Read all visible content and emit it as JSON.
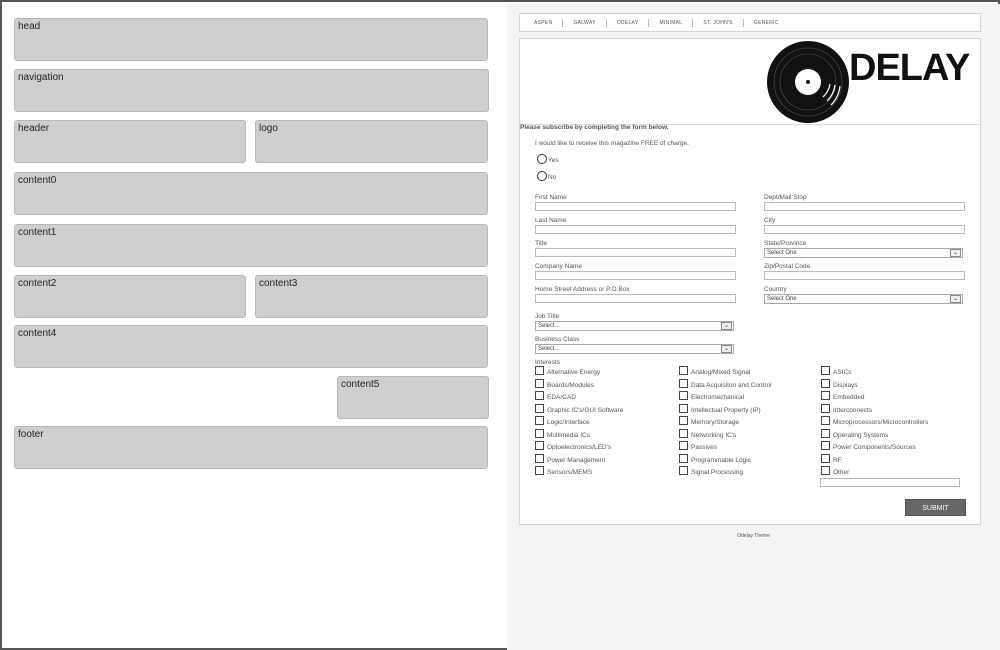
{
  "wireframe": {
    "head": "head",
    "navigation": "navigation",
    "header": "header",
    "logo": "logo",
    "content0": "content0",
    "content1": "content1",
    "content2": "content2",
    "content3": "content3",
    "content4": "content4",
    "content5": "content5",
    "footer": "footer"
  },
  "nav": [
    "ASPEN",
    "GALWAY",
    "ODELAY",
    "MINIMAL",
    "ST. JOHN'S",
    "GENERIC"
  ],
  "brand": "DELAY",
  "form": {
    "title": "Please subscribe by completing the form below.",
    "receive_question": "I would like to receive this magazine FREE of charge.",
    "yes": "Yes",
    "no": "No",
    "first_name": "First Name",
    "dept": "Dept/Mail Stop",
    "last_name": "Last Name",
    "city": "City",
    "title_label": "Title",
    "state": "State/Province",
    "state_value": "Select One",
    "company": "Company Name",
    "zip": "Zip/Postal Code",
    "address": "Home Street Address or P.O.Box",
    "country": "Country",
    "country_value": "Select One",
    "job_title": "Job Title",
    "job_title_value": "Select...",
    "business_class": "Business Class",
    "business_class_value": "Select...",
    "interests_label": "Interests",
    "interests_col1": [
      "Alternative Energy",
      "Boards/Modules",
      "EDA/CAD",
      "Graphic IC's/GUI Software",
      "Logic/Interface",
      "Multimedia ICs",
      "Optoelectronics/LED's",
      "Power Management",
      "Sensors/MEMS"
    ],
    "interests_col2": [
      "Analog/Mixed Signal",
      "Data Acquisiton and Control",
      "Electromechanical",
      "Intellectual Property (IP)",
      "Memory/Storage",
      "Networking IC's",
      "Passives",
      "Programmable Logic",
      "Signal Processing"
    ],
    "interests_col3": [
      "ASICs",
      "Displays",
      "Embedded",
      "Interconnects",
      "Microprocessors/Microcontrollers",
      "Operating Systems",
      "Power Components/Sources",
      "RF",
      "Other"
    ],
    "submit": "SUBMIT"
  },
  "footer_text": "Odelay Theme"
}
